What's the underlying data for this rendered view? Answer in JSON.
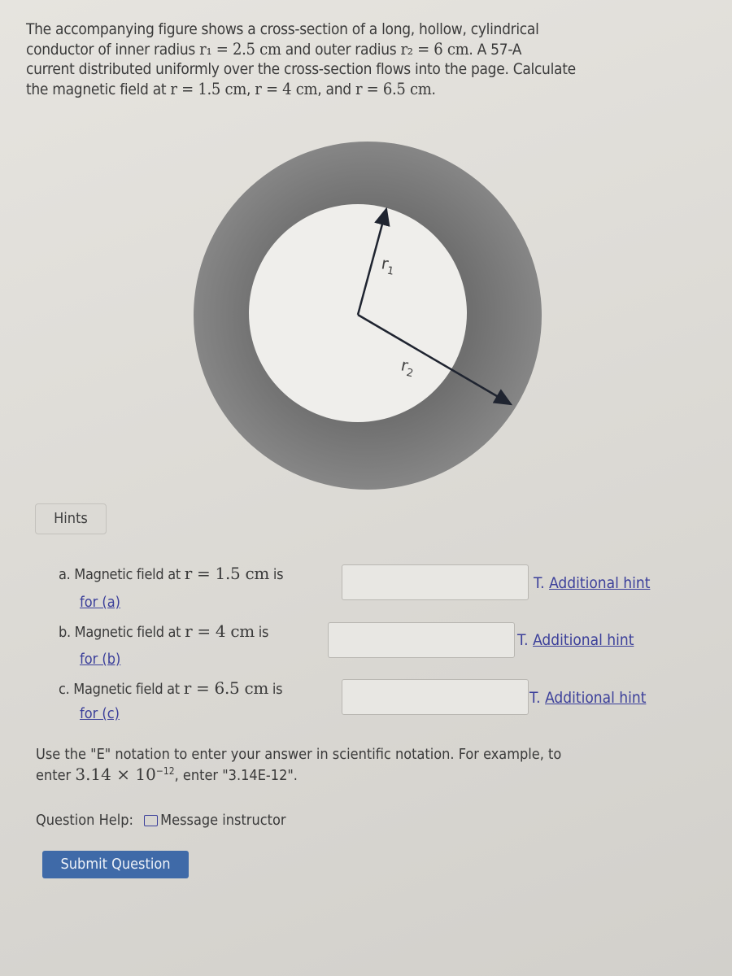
{
  "problem": {
    "line1": "The accompanying figure shows a cross-section of a long, hollow, cylindrical",
    "line2_pre": "conductor of inner radius ",
    "r1_expr": "r₁ = 2.5  cm",
    "line2_mid": " and outer radius ",
    "r2_expr": "r₂ = 6  cm",
    "line2_post": ". A 57-A",
    "line3": "current distributed uniformly over the cross-section flows into the page. Calculate",
    "line4_pre": "the magnetic field at ",
    "ra": "r = 1.5  cm",
    "sep1": ", ",
    "rb": "r = 4  cm",
    "sep2": ", and ",
    "rc": "r = 6.5  cm",
    "end": "."
  },
  "figure": {
    "label_r1": "r1",
    "label_r2": "r2",
    "ring_color": "#7d7d7d",
    "inner_color": "#f0efec"
  },
  "hints_button": "Hints",
  "questions": [
    {
      "prefix": "a. Magnetic field at ",
      "expr": "r = 1.5  cm",
      "suffix": " is",
      "value": "",
      "unit": "T.",
      "hint": "Additional hint",
      "for": "for (a)"
    },
    {
      "prefix": "b. Magnetic field at ",
      "expr": "r = 4  cm",
      "suffix": " is",
      "value": "",
      "unit": "T.",
      "hint": "Additional hint",
      "for": "for (b)"
    },
    {
      "prefix": "c. Magnetic field at ",
      "expr": "r = 6.5  cm",
      "suffix": " is",
      "value": "",
      "unit": "T.",
      "hint": "Additional hint",
      "for": "for (c)"
    }
  ],
  "note": {
    "line1": "Use the \"E\" notation to enter your answer in scientific notation. For example, to",
    "line2_pre": "enter ",
    "example_base": "3.14 × 10",
    "example_exp": "−12",
    "line2_post": ", enter \"3.14E-12\"."
  },
  "help": {
    "label": "Question Help:",
    "message": "Message instructor"
  },
  "submit": "Submit Question"
}
